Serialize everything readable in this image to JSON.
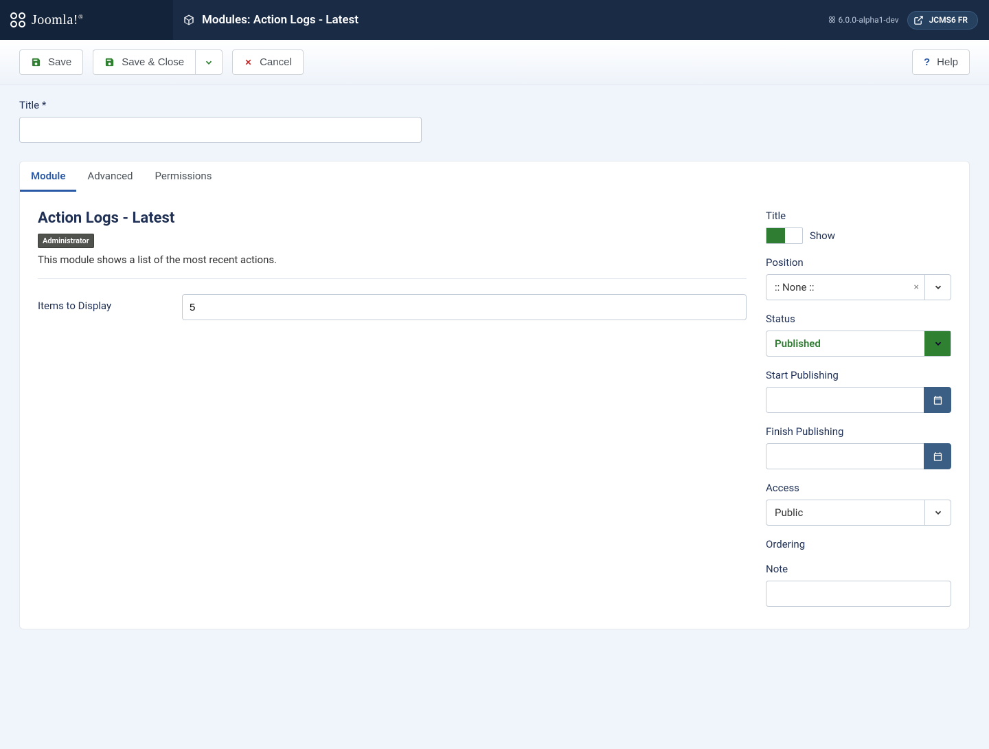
{
  "header": {
    "brand": "Joomla!",
    "page_title": "Modules: Action Logs - Latest",
    "version": "6.0.0-alpha1-dev",
    "user": "JCMS6 FR"
  },
  "toolbar": {
    "save": "Save",
    "save_close": "Save & Close",
    "cancel": "Cancel",
    "help": "Help"
  },
  "title_field": {
    "label": "Title *",
    "value": ""
  },
  "tabs": {
    "module": "Module",
    "advanced": "Advanced",
    "permissions": "Permissions"
  },
  "module": {
    "heading": "Action Logs - Latest",
    "badge": "Administrator",
    "description": "This module shows a list of the most recent actions.",
    "items_to_display": {
      "label": "Items to Display",
      "value": "5"
    }
  },
  "side": {
    "title": {
      "label": "Title",
      "text": "Show"
    },
    "position": {
      "label": "Position",
      "value": ":: None ::"
    },
    "status": {
      "label": "Status",
      "value": "Published"
    },
    "start_publishing": {
      "label": "Start Publishing",
      "value": ""
    },
    "finish_publishing": {
      "label": "Finish Publishing",
      "value": ""
    },
    "access": {
      "label": "Access",
      "value": "Public"
    },
    "ordering": {
      "label": "Ordering"
    },
    "note": {
      "label": "Note",
      "value": ""
    }
  }
}
